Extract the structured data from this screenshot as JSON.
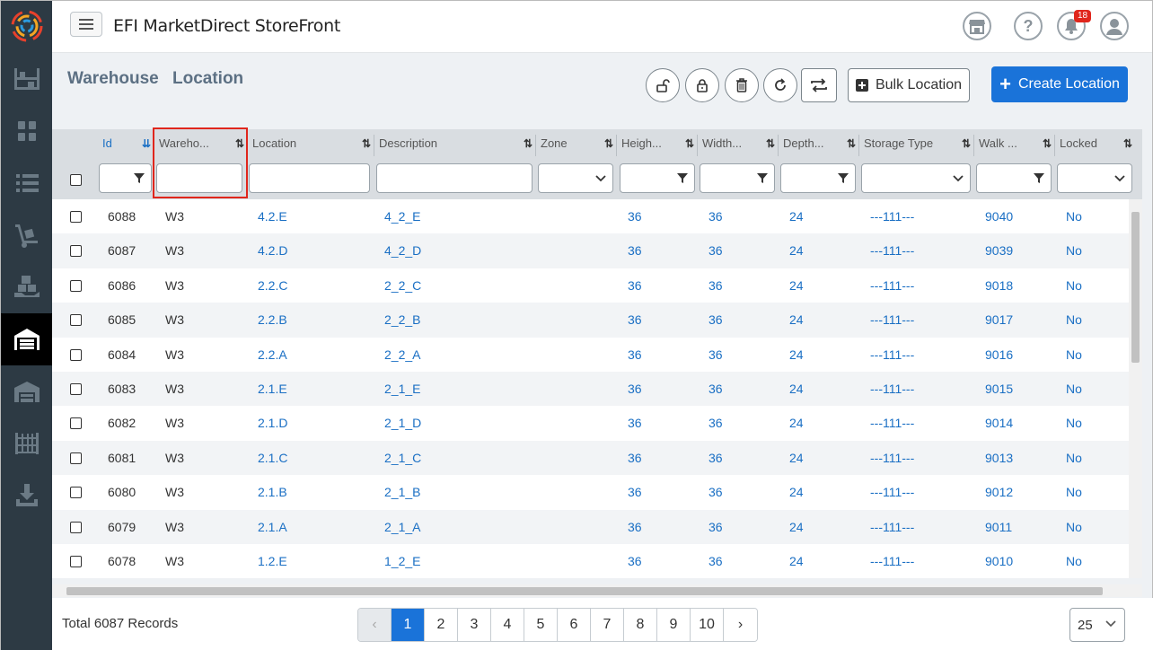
{
  "app": {
    "title": "EFI MarketDirect StoreFront",
    "notification_count": "18"
  },
  "breadcrumb": [
    "Warehouse",
    "Location"
  ],
  "toolbar": {
    "bulk_label": "Bulk Location",
    "create_label": "Create Location"
  },
  "columns": [
    {
      "label": "Id"
    },
    {
      "label": "Wareho..."
    },
    {
      "label": "Location"
    },
    {
      "label": "Description"
    },
    {
      "label": "Zone"
    },
    {
      "label": "Heigh..."
    },
    {
      "label": "Width..."
    },
    {
      "label": "Depth..."
    },
    {
      "label": "Storage Type"
    },
    {
      "label": "Walk ..."
    },
    {
      "label": "Locked"
    }
  ],
  "rows": [
    [
      "6088",
      "W3",
      "4.2.E",
      "4_2_E",
      "36",
      "36",
      "24",
      "---111---",
      "9040",
      "No"
    ],
    [
      "6087",
      "W3",
      "4.2.D",
      "4_2_D",
      "36",
      "36",
      "24",
      "---111---",
      "9039",
      "No"
    ],
    [
      "6086",
      "W3",
      "2.2.C",
      "2_2_C",
      "36",
      "36",
      "24",
      "---111---",
      "9018",
      "No"
    ],
    [
      "6085",
      "W3",
      "2.2.B",
      "2_2_B",
      "36",
      "36",
      "24",
      "---111---",
      "9017",
      "No"
    ],
    [
      "6084",
      "W3",
      "2.2.A",
      "2_2_A",
      "36",
      "36",
      "24",
      "---111---",
      "9016",
      "No"
    ],
    [
      "6083",
      "W3",
      "2.1.E",
      "2_1_E",
      "36",
      "36",
      "24",
      "---111---",
      "9015",
      "No"
    ],
    [
      "6082",
      "W3",
      "2.1.D",
      "2_1_D",
      "36",
      "36",
      "24",
      "---111---",
      "9014",
      "No"
    ],
    [
      "6081",
      "W3",
      "2.1.C",
      "2_1_C",
      "36",
      "36",
      "24",
      "---111---",
      "9013",
      "No"
    ],
    [
      "6080",
      "W3",
      "2.1.B",
      "2_1_B",
      "36",
      "36",
      "24",
      "---111---",
      "9012",
      "No"
    ],
    [
      "6079",
      "W3",
      "2.1.A",
      "2_1_A",
      "36",
      "36",
      "24",
      "---111---",
      "9011",
      "No"
    ],
    [
      "6078",
      "W3",
      "1.2.E",
      "1_2_E",
      "36",
      "36",
      "24",
      "---111---",
      "9010",
      "No"
    ]
  ],
  "footer": {
    "total": "Total 6087 Records",
    "pages": [
      "1",
      "2",
      "3",
      "4",
      "5",
      "6",
      "7",
      "8",
      "9",
      "10"
    ],
    "page_size": "25"
  }
}
